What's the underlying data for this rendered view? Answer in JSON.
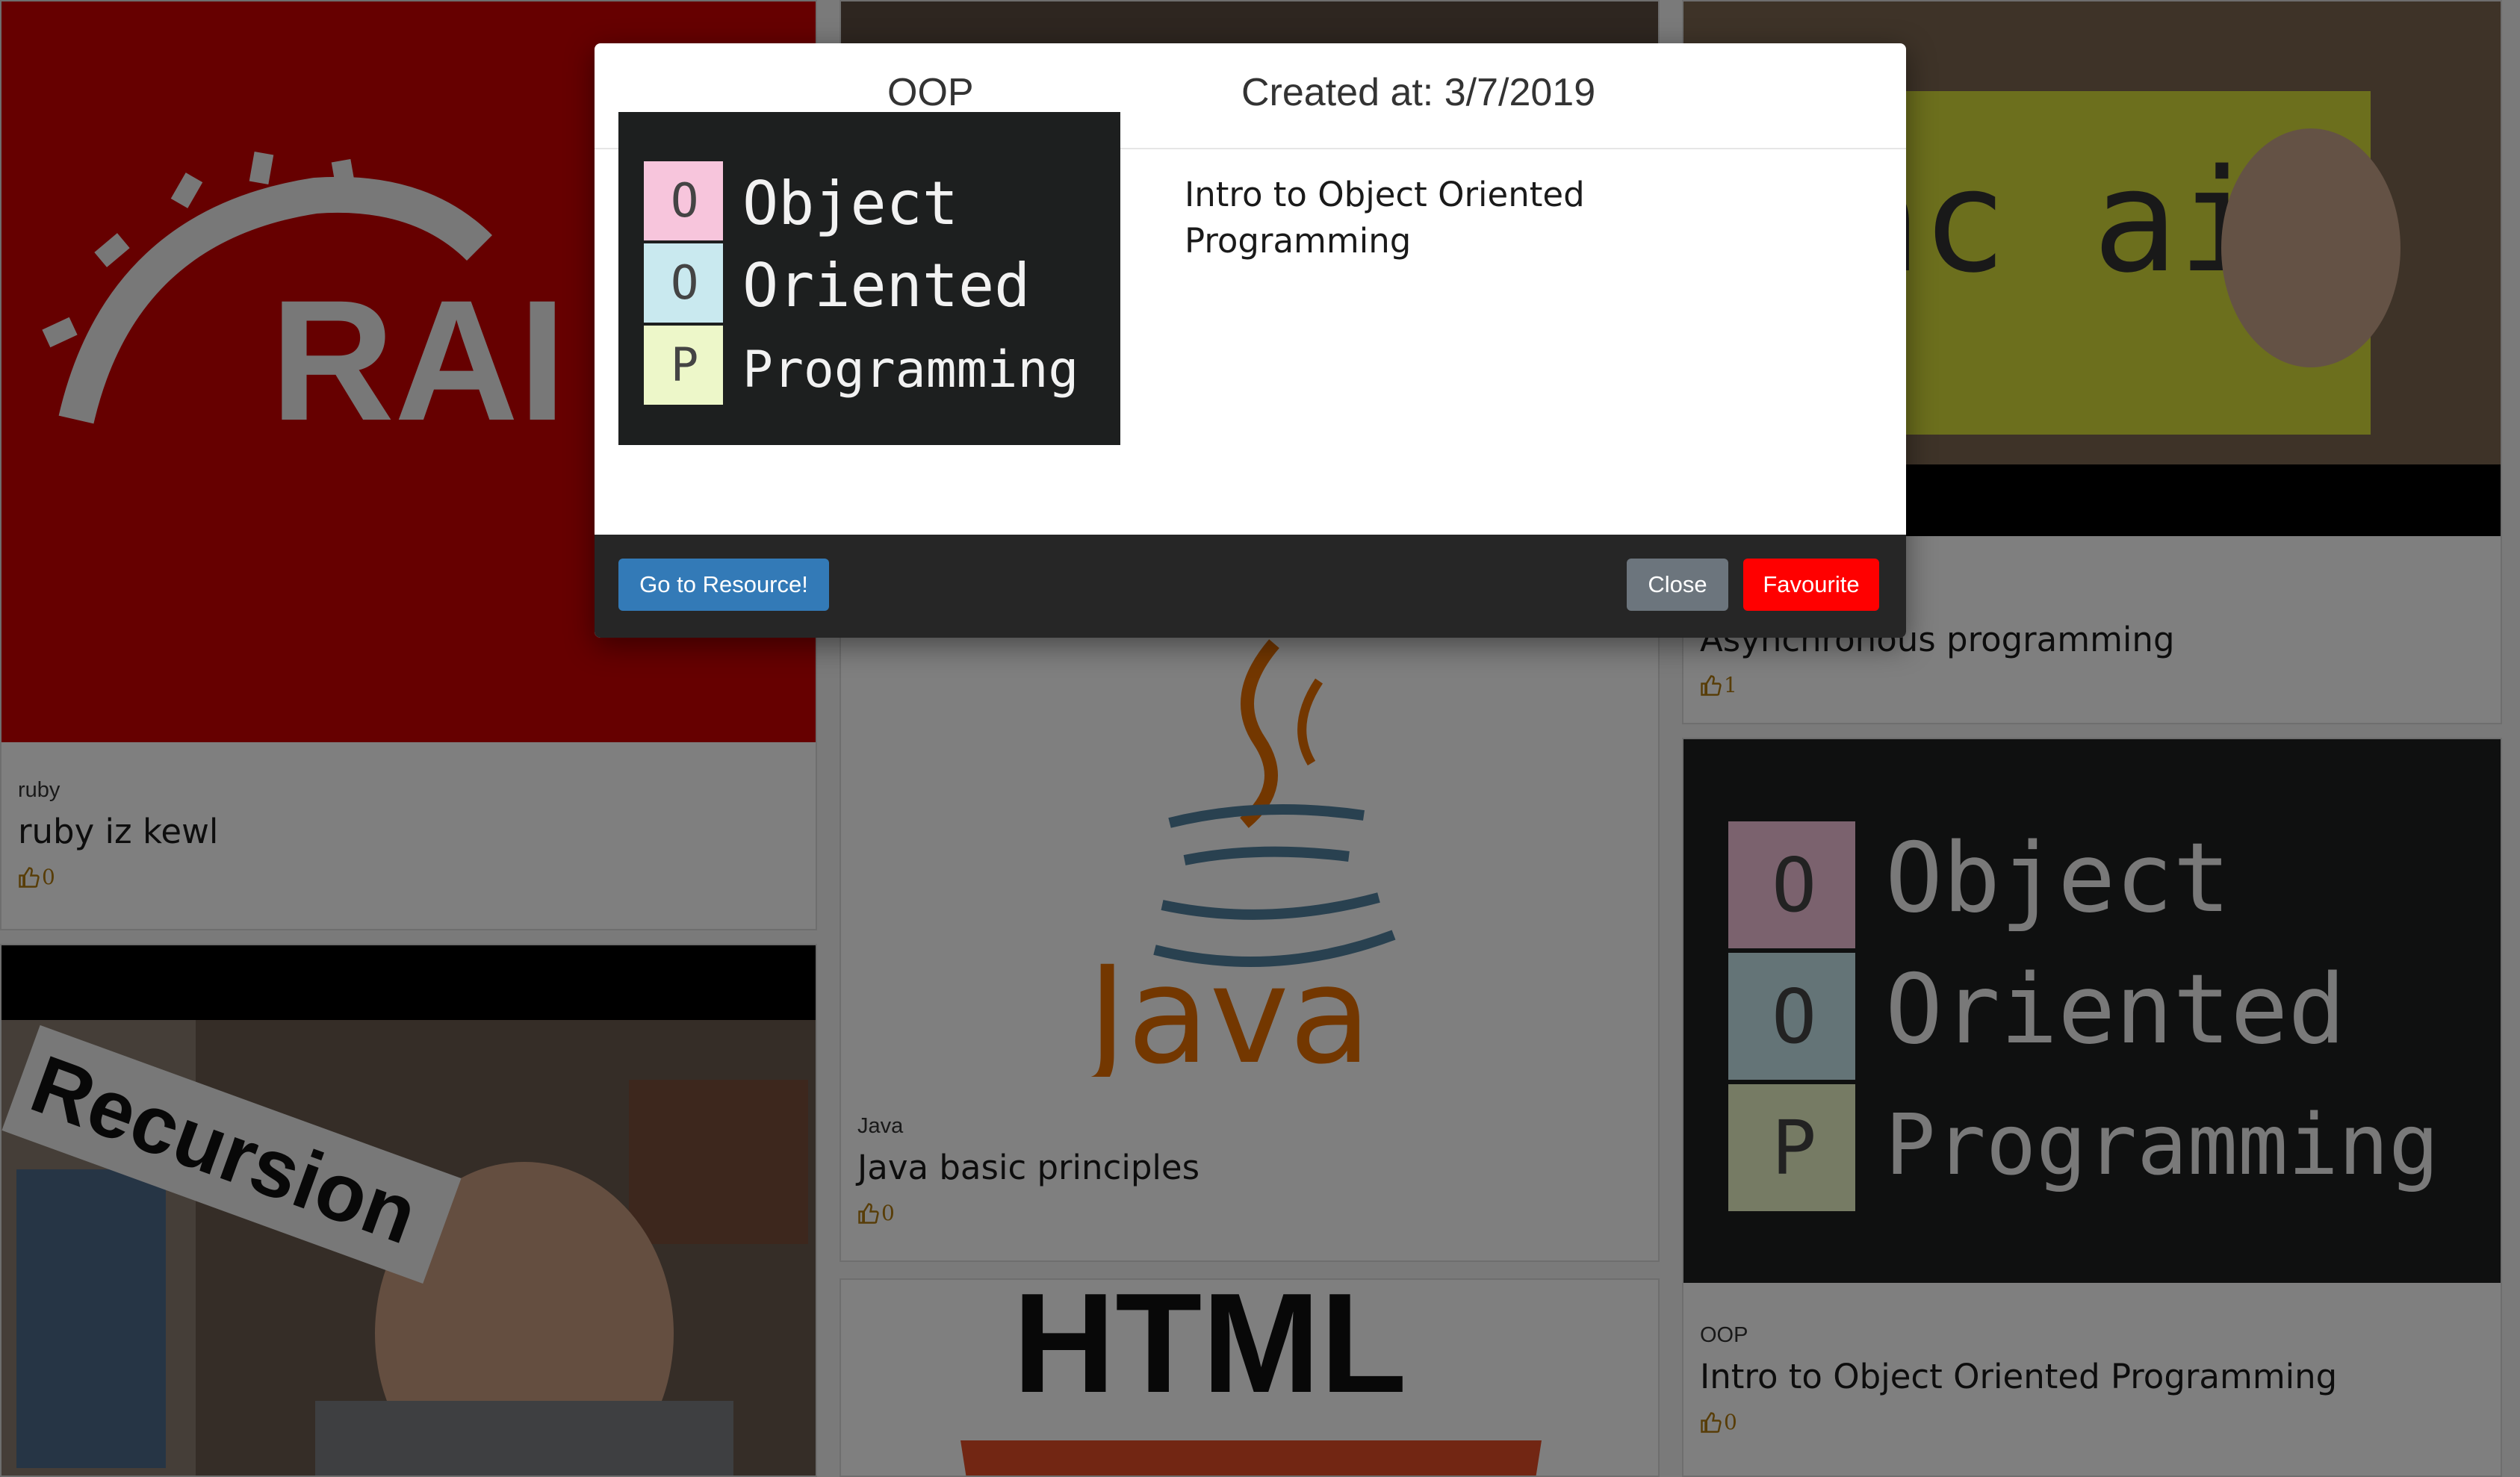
{
  "modal": {
    "title": "OOP",
    "created": "Created at: 3/7/2019",
    "description": "Intro to Object Oriented Programming",
    "buttons": {
      "resource": "Go to Resource!",
      "close": "Close",
      "favourite": "Favourite"
    }
  },
  "oop_image": {
    "letters": [
      "O",
      "O",
      "P"
    ],
    "words": [
      "Object",
      "Oriented",
      "Programming"
    ]
  },
  "cards": {
    "ruby": {
      "category": "ruby",
      "title": "ruby iz kewl",
      "likes": "0",
      "logo_text": "RAI"
    },
    "async": {
      "title": "Asynchronous programming",
      "likes": "1",
      "sign_text": "ync ait"
    },
    "java": {
      "category": "Java",
      "title": "Java basic principles",
      "likes": "0",
      "logo_text": "Java"
    },
    "oop": {
      "category": "OOP",
      "title": "Intro to Object Oriented Programming",
      "likes": "0"
    },
    "recursion": {
      "banner": "Recursion"
    },
    "html": {
      "logo_text": "HTML"
    }
  },
  "colors": {
    "rails_red": "#cc0000",
    "java_red": "#e76f00",
    "java_blue": "#5382a1",
    "go_button": "#337ab7",
    "close_button": "#6c757d",
    "favourite_button": "#ff0000",
    "like_color": "#b07a10"
  },
  "icons": {
    "like": "thumbs-up-icon"
  }
}
